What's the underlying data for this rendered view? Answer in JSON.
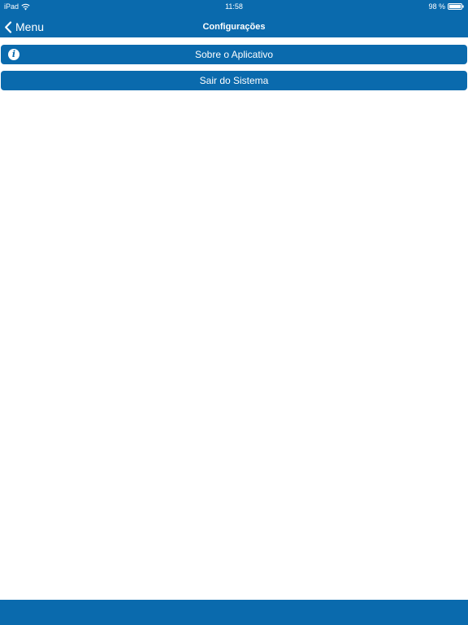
{
  "status_bar": {
    "device": "iPad",
    "time": "11:58",
    "battery": "98 %",
    "wifi_icon": "wifi-icon",
    "battery_icon": "battery-icon"
  },
  "nav": {
    "back_label": "Menu",
    "back_icon": "chevron-left-icon",
    "title": "Configurações"
  },
  "buttons": {
    "about_label": "Sobre o Aplicativo",
    "about_icon": "info-icon",
    "logout_label": "Sair do Sistema"
  },
  "colors": {
    "brand": "#0a6aad",
    "text_on_brand": "#ffffff",
    "background": "#ffffff"
  }
}
